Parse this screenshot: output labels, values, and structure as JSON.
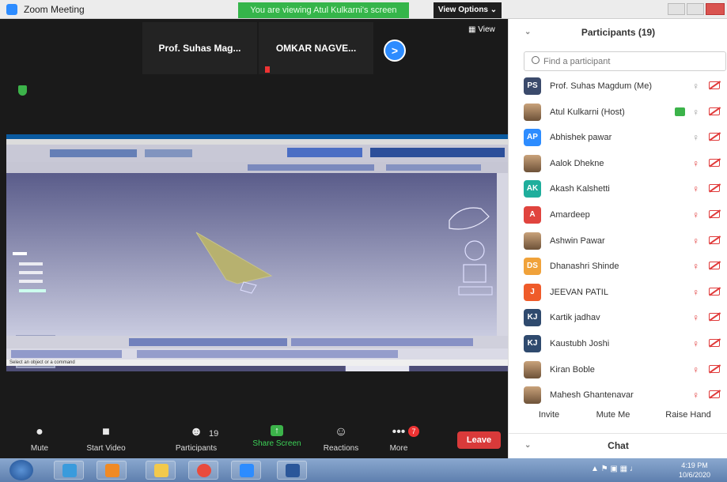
{
  "window": {
    "title": "Zoom Meeting",
    "banner": "You are viewing Atul Kulkarni's screen",
    "view_options": "View Options ⌄"
  },
  "video": {
    "tiles": [
      "Prof. Suhas Mag...",
      "OMKAR NAGVE..."
    ],
    "view_label": "▦ View"
  },
  "shared_screen": {
    "status_text": "Select an object or a command"
  },
  "controls": {
    "mute": "Mute",
    "start_video": "Start Video",
    "participants": "Participants",
    "participants_count": "19",
    "share_screen": "Share Screen",
    "reactions": "Reactions",
    "more": "More",
    "more_badge": "7",
    "leave": "Leave"
  },
  "panel": {
    "title": "Participants (19)",
    "search_placeholder": "Find a participant",
    "participants": [
      {
        "initials": "PS",
        "name": "Prof. Suhas Magdum (Me)",
        "color": "#3b4a6b"
      },
      {
        "initials": "",
        "name": "Atul Kulkarni (Host)",
        "color": ""
      },
      {
        "initials": "AP",
        "name": "Abhishek pawar",
        "color": "#2d8cff"
      },
      {
        "initials": "",
        "name": "Aalok Dhekne",
        "color": ""
      },
      {
        "initials": "AK",
        "name": "Akash Kalshetti",
        "color": "#1fae9c"
      },
      {
        "initials": "A",
        "name": "Amardeep",
        "color": "#e0443e"
      },
      {
        "initials": "",
        "name": "Ashwin Pawar",
        "color": ""
      },
      {
        "initials": "DS",
        "name": "Dhanashri Shinde",
        "color": "#f0a23a"
      },
      {
        "initials": "J",
        "name": "JEEVAN PATIL",
        "color": "#ef5b2a"
      },
      {
        "initials": "KJ",
        "name": "Kartik jadhav",
        "color": "#2f4a6e"
      },
      {
        "initials": "KJ",
        "name": "Kaustubh Joshi",
        "color": "#2f4a6e"
      },
      {
        "initials": "",
        "name": "Kiran Boble",
        "color": ""
      },
      {
        "initials": "",
        "name": "Mahesh Ghantenavar",
        "color": ""
      }
    ],
    "invite": "Invite",
    "mute_me": "Mute Me",
    "raise_hand": "Raise Hand",
    "chat": "Chat"
  },
  "taskbar": {
    "time": "4:19 PM",
    "date": "10/6/2020"
  }
}
